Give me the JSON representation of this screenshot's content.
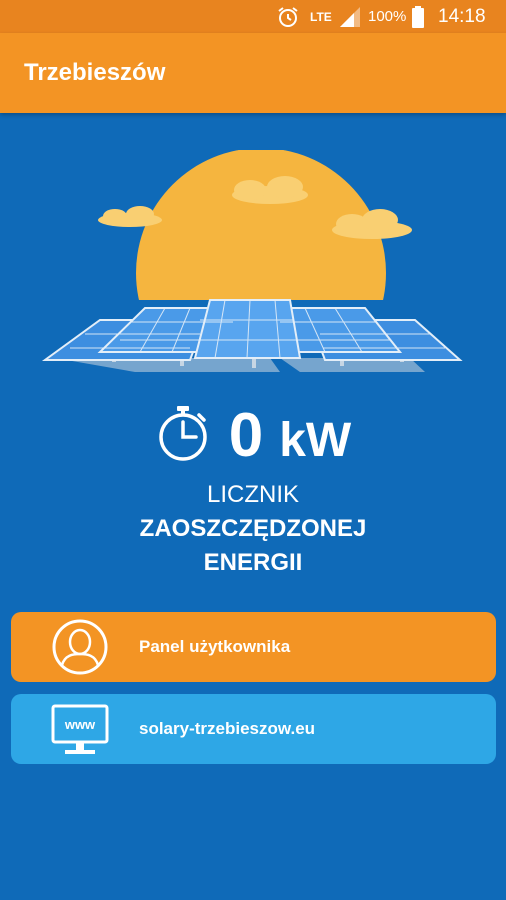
{
  "status_bar": {
    "network": "LTE",
    "battery": "100%",
    "time": "14:18",
    "icons": [
      "alarm-icon",
      "signal-icon",
      "battery-icon"
    ]
  },
  "app_bar": {
    "title": "Trzebieszów"
  },
  "counter": {
    "value": "0",
    "unit": "kW",
    "caption_line1": "LICZNIK",
    "caption_line2": "ZAOSZCZĘDZONEJ",
    "caption_line3": "ENERGII"
  },
  "buttons": {
    "user_panel": {
      "label": "Panel użytkownika",
      "icon": "user-avatar-icon"
    },
    "website": {
      "label": "solary-trzebieszow.eu",
      "icon": "www-monitor-icon",
      "icon_text": "www"
    }
  },
  "colors": {
    "background": "#0f6ab8",
    "accent_orange": "#f39424",
    "accent_blue": "#2ea7e6",
    "sun": "#f5b53f"
  }
}
